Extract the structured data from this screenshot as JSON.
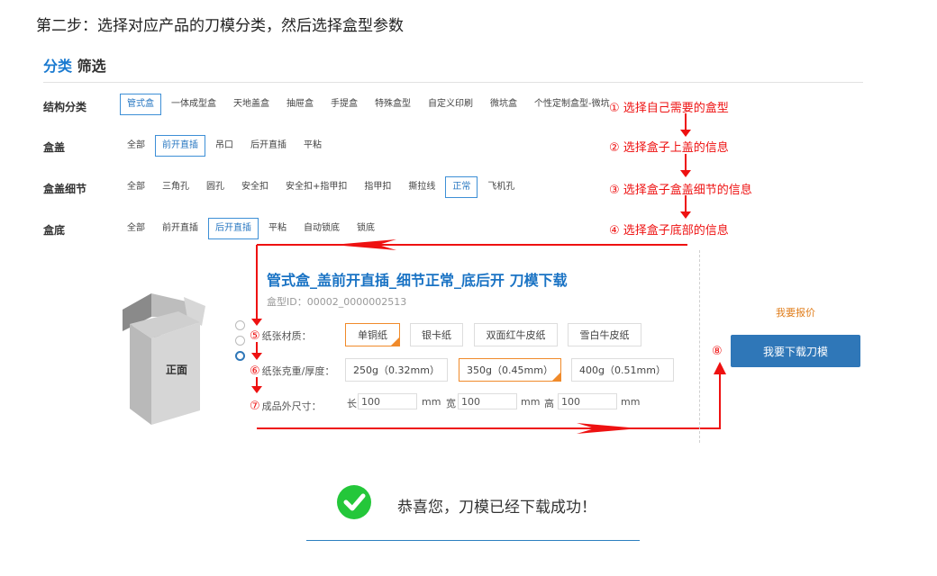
{
  "step_title": "第二步：选择对应产品的刀模分类，然后选择盒型参数",
  "filter_heading": {
    "part1": "分类",
    "part2": "筛选"
  },
  "rows": [
    {
      "label": "结构分类",
      "options": [
        "管式盒",
        "一体成型盒",
        "天地盖盒",
        "抽屉盒",
        "手提盒",
        "特殊盒型",
        "自定义印刷",
        "微坑盒",
        "个性定制盒型-微坑"
      ],
      "selected": 0
    },
    {
      "label": "盒盖",
      "options": [
        "全部",
        "前开直插",
        "吊口",
        "后开直插",
        "平粘"
      ],
      "selected": 1
    },
    {
      "label": "盒盖细节",
      "options": [
        "全部",
        "三角孔",
        "圆孔",
        "安全扣",
        "安全扣+指甲扣",
        "指甲扣",
        "撕拉线",
        "正常",
        "飞机孔"
      ],
      "selected": 7
    },
    {
      "label": "盒底",
      "options": [
        "全部",
        "前开直插",
        "后开直插",
        "平粘",
        "自动锁底",
        "锁底"
      ],
      "selected": 2
    }
  ],
  "annotations": [
    "① 选择自己需要的盒型",
    "② 选择盒子上盖的信息",
    "③ 选择盒子盒盖细节的信息",
    "④ 选择盒子底部的信息"
  ],
  "product": {
    "title": "管式盒_盖前开直插_细节正常_底后开 刀模下载",
    "id_text": "盒型ID：00002_0000002513",
    "box_face_label": "正面",
    "paper_material": {
      "num": "⑤",
      "label": "纸张材质：",
      "options": [
        "单铜纸",
        "银卡纸",
        "双面红牛皮纸",
        "雪白牛皮纸"
      ],
      "selected": 0
    },
    "paper_weight": {
      "num": "⑥",
      "label": "纸张克重/厚度：",
      "options": [
        "250g（0.32mm）",
        "350g（0.45mm）",
        "400g（0.51mm）"
      ],
      "selected": 1
    },
    "dimensions": {
      "num": "⑦",
      "label": "成品外尺寸：",
      "length_label": "长",
      "length_value": "100",
      "width_label": "宽",
      "width_value": "100",
      "height_label": "高",
      "height_value": "100",
      "unit": "mm"
    }
  },
  "quote_link": "我要报价",
  "download": {
    "num": "⑧",
    "label": "我要下载刀模"
  },
  "success_message": "恭喜您，刀模已经下载成功！",
  "colors": {
    "accent_blue": "#2f77b8",
    "annotation_red": "#e11111",
    "success_green": "#24c73a",
    "selected_orange": "#f08a2a"
  }
}
